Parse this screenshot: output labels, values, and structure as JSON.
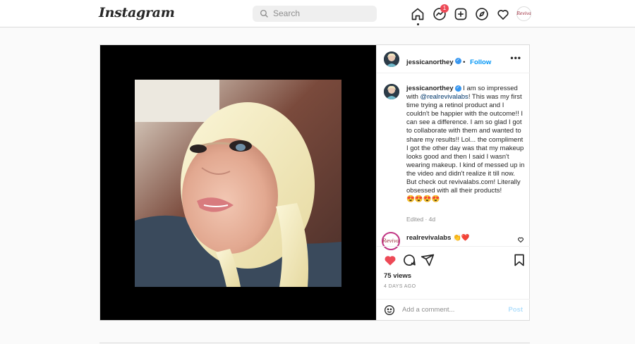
{
  "header": {
    "logo": "Instagram",
    "search_placeholder": "Search",
    "messages_badge": "1",
    "profile_logo_text": "Reviva"
  },
  "post": {
    "username": "jessicanorthey",
    "verified_mark": "✓",
    "follow_label": "Follow",
    "more_label": "•••",
    "caption_intro": "I am so impressed with ",
    "caption_mention": "@realrevivalabs",
    "caption_body": "! This was my first time trying a retinol product and I couldn't be happier with the outcome!! I can see a difference. I am so glad I got to collaborate with them and wanted to share my results!! Lol... the compliment I got the other day was that my makeup looks good and then I said I wasn't wearing makeup. I kind of messed up in the video and didn't realize it till now. But check out revivalabs.com! Literally obsessed with all their products!",
    "caption_emojis": "😍😍😍😍",
    "edited": "Edited · 4d",
    "comment_username": "realrevivalabs",
    "comment_text": "👏❤️",
    "comment_avatar_text": "Reviva",
    "views": "75 views",
    "date": "4 DAYS AGO",
    "add_comment_placeholder": "Add a comment...",
    "post_button": "Post"
  },
  "colors": {
    "accent": "#0095f6",
    "like": "#ed4956",
    "badge": "#ed4956"
  }
}
